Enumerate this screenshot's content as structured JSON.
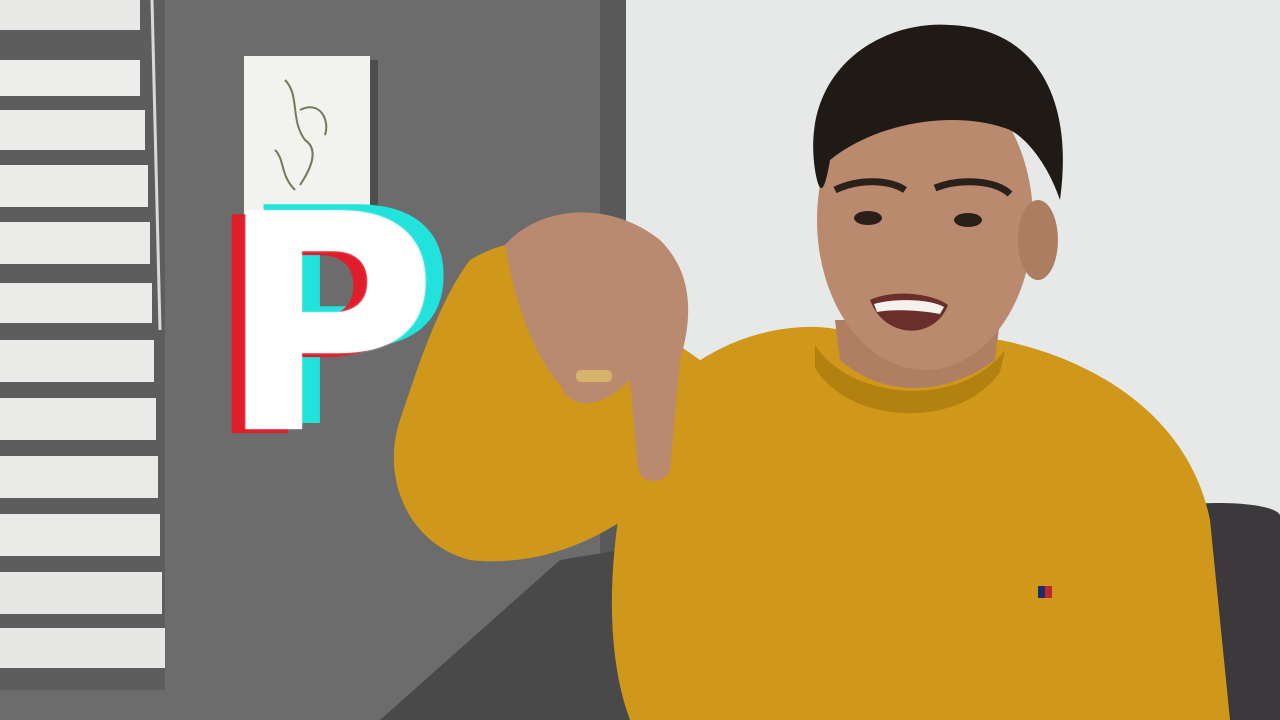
{
  "scene": {
    "description_tag": "video-frame",
    "colors": {
      "wall": "#6f6f6f",
      "wall_right": "#e9eaea",
      "sweater": "#d19a1c",
      "skin": "#b8876c",
      "hair": "#1f1a16",
      "couch": "#3c3a3d",
      "glitch_red": "#e11d2b",
      "glitch_cyan": "#22e2dc",
      "glitch_white": "#ffffff"
    }
  },
  "overlay": {
    "letter": "P"
  }
}
